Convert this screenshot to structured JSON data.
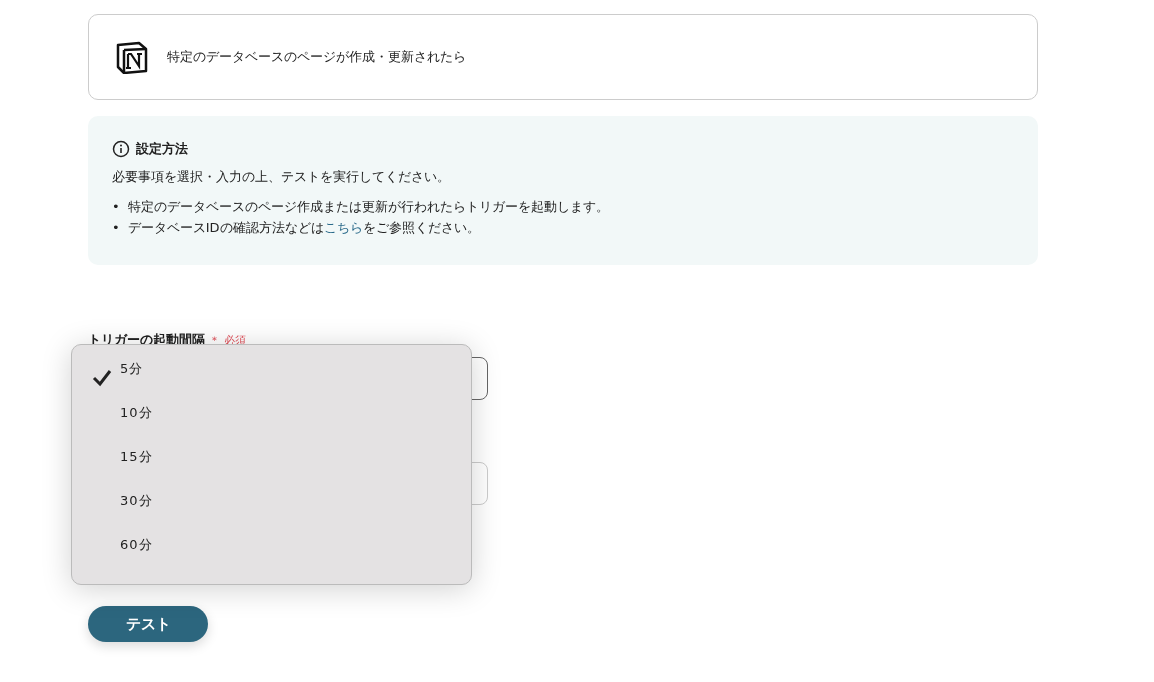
{
  "trigger_card": {
    "title": "特定のデータベースのページが作成・更新されたら"
  },
  "info": {
    "heading": "設定方法",
    "intro": "必要事項を選択・入力の上、テストを実行してください。",
    "bullets": [
      {
        "marker": "•",
        "before": "特定のデータベースのページ作成または更新が行われたらトリガーを起動します。"
      },
      {
        "marker": "•",
        "before": "データベースIDの確認方法などは",
        "link": "こちら",
        "after": "をご参照ください。"
      }
    ]
  },
  "interval": {
    "label": "トリガーの起動間隔",
    "required_mark": "＊",
    "required": "必須",
    "options": [
      {
        "label": "5分",
        "selected": true
      },
      {
        "label": "10分",
        "selected": false
      },
      {
        "label": "15分",
        "selected": false
      },
      {
        "label": "30分",
        "selected": false
      },
      {
        "label": "60分",
        "selected": false
      }
    ]
  },
  "test_button": "テスト"
}
